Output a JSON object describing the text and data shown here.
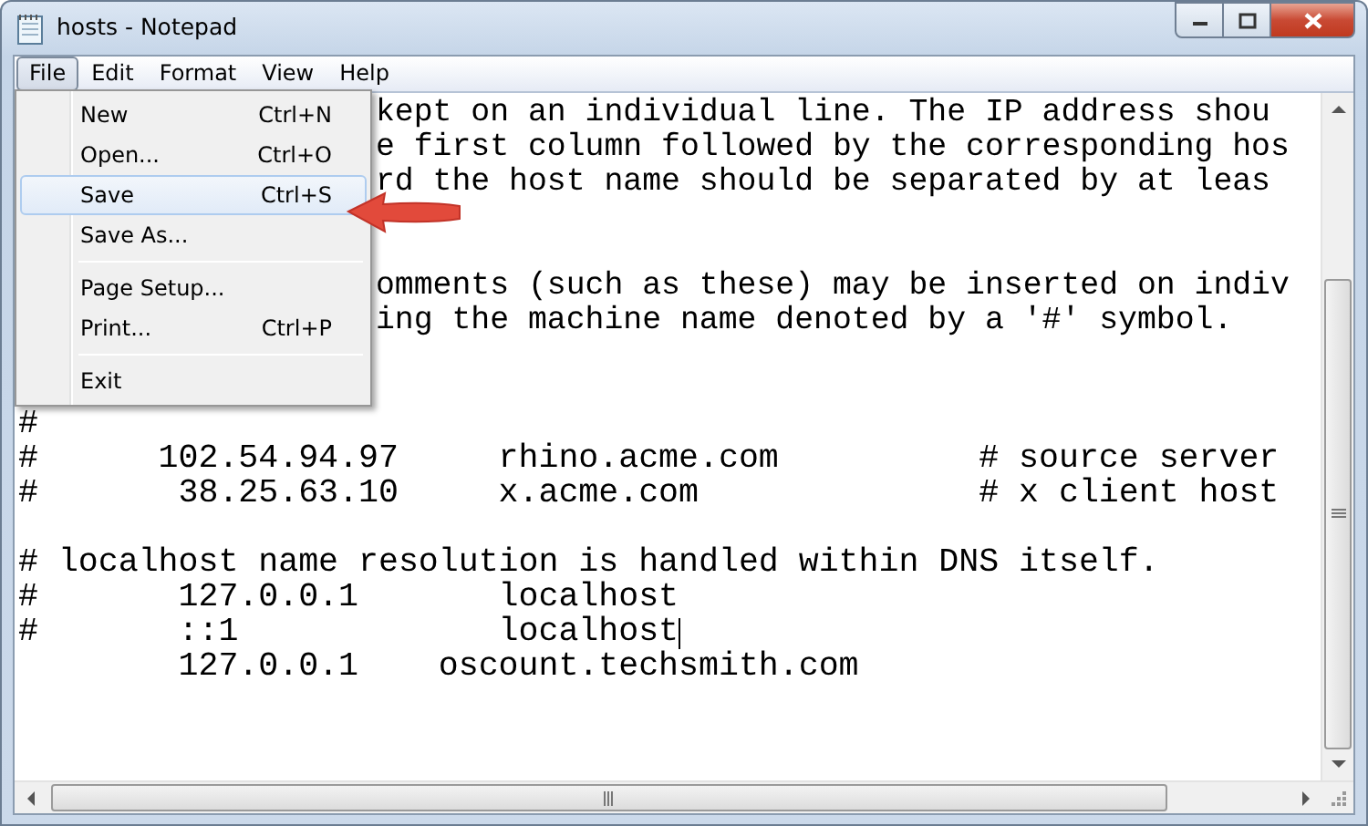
{
  "window": {
    "title": "hosts - Notepad"
  },
  "menu_bar": [
    {
      "label": "File",
      "selected": true
    },
    {
      "label": "Edit",
      "selected": false
    },
    {
      "label": "Format",
      "selected": false
    },
    {
      "label": "View",
      "selected": false
    },
    {
      "label": "Help",
      "selected": false
    }
  ],
  "file_menu": {
    "items": [
      {
        "kind": "item",
        "label": "New",
        "shortcut": "Ctrl+N",
        "selected": false
      },
      {
        "kind": "item",
        "label": "Open...",
        "shortcut": "Ctrl+O",
        "selected": false
      },
      {
        "kind": "item",
        "label": "Save",
        "shortcut": "Ctrl+S",
        "selected": true
      },
      {
        "kind": "item",
        "label": "Save As...",
        "selected": false
      },
      {
        "kind": "separator"
      },
      {
        "kind": "item",
        "label": "Page Setup...",
        "selected": false
      },
      {
        "kind": "item",
        "label": "Print...",
        "shortcut": "Ctrl+P",
        "selected": false
      },
      {
        "kind": "separator"
      },
      {
        "kind": "item",
        "label": "Exit",
        "selected": false
      }
    ]
  },
  "editor": {
    "lines": [
      {
        "kind": "text",
        "text": "kept on an individual line. The IP address shou",
        "behind_menu": true,
        "caret": false
      },
      {
        "kind": "text",
        "text": "e first column followed by the corresponding hos",
        "behind_menu": true,
        "caret": false
      },
      {
        "kind": "text",
        "text": "rd the host name should be separated by at leas",
        "behind_menu": true,
        "caret": false
      },
      {
        "kind": "blank"
      },
      {
        "kind": "blank"
      },
      {
        "kind": "text",
        "text": "omments (such as these) may be inserted on indiv",
        "behind_menu": true,
        "caret": false
      },
      {
        "kind": "text",
        "text": "ing the machine name denoted by a '#' symbol.",
        "behind_menu": true,
        "caret": false
      },
      {
        "kind": "blank"
      },
      {
        "kind": "blank"
      },
      {
        "kind": "text",
        "text": "#",
        "behind_menu": false,
        "caret": false
      },
      {
        "kind": "text",
        "text": "#      102.54.94.97     rhino.acme.com          # source server",
        "behind_menu": false,
        "caret": false
      },
      {
        "kind": "text",
        "text": "#       38.25.63.10     x.acme.com              # x client host",
        "behind_menu": false,
        "caret": false
      },
      {
        "kind": "blank"
      },
      {
        "kind": "text",
        "text": "# localhost name resolution is handled within DNS itself.",
        "behind_menu": false,
        "caret": false
      },
      {
        "kind": "text",
        "text": "#       127.0.0.1       localhost",
        "behind_menu": false,
        "caret": false
      },
      {
        "kind": "text",
        "text": "#       ::1             localhost",
        "behind_menu": false,
        "caret": true
      },
      {
        "kind": "text",
        "text": "        127.0.0.1    oscount.techsmith.com",
        "behind_menu": false,
        "caret": false
      }
    ]
  }
}
